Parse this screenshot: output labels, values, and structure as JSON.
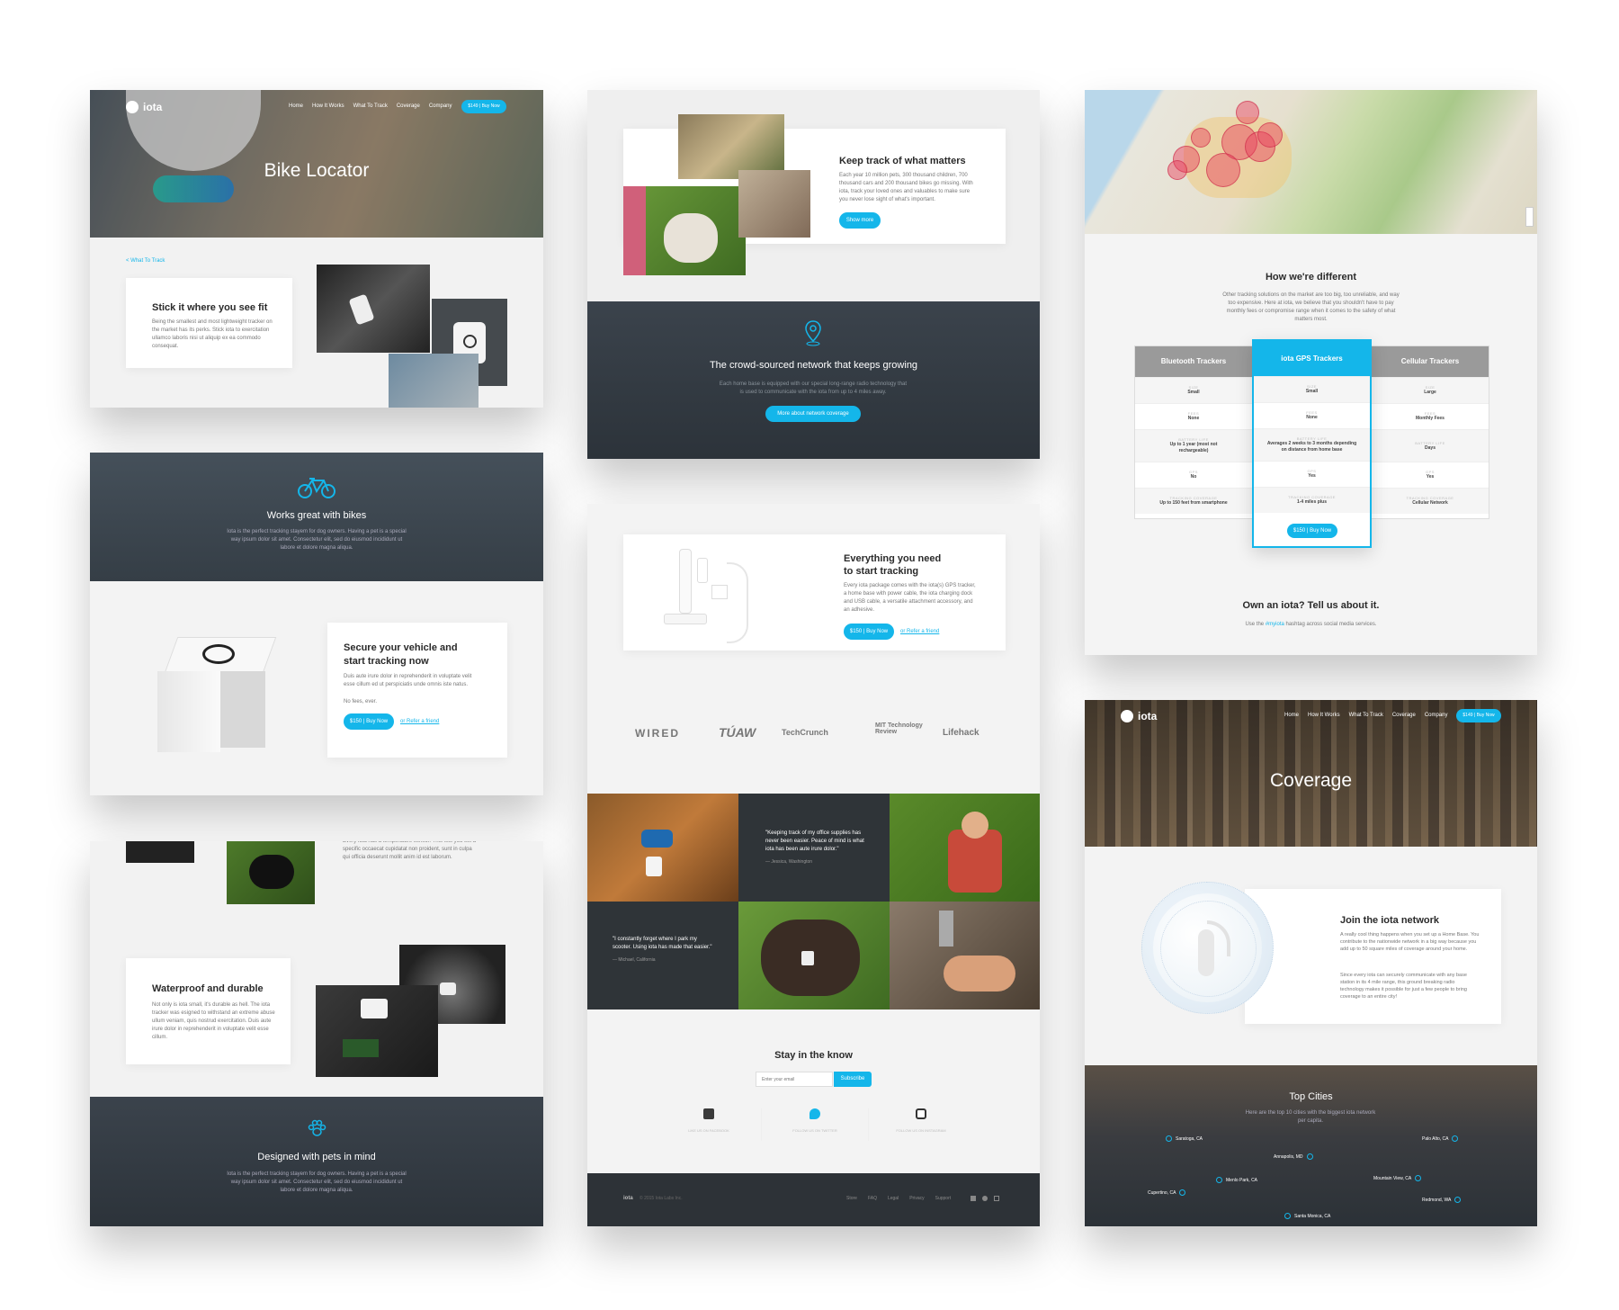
{
  "colors": {
    "accent": "#14b6ea",
    "dark": "#2f363d"
  },
  "brand": "iota",
  "nav": [
    "Home",
    "How It Works",
    "What To Track",
    "Coverage",
    "Company"
  ],
  "buy_nav": "$149 | Buy Now",
  "card1": {
    "hero_title": "Bike Locator",
    "breadcrumb": "< What To Track",
    "title": "Stick it where you see fit",
    "body": "Being the smallest and most lightweight tracker on the market has its perks. Stick iota to exercitation ullamco laboris nisi ut aliquip ex ea commodo consequat."
  },
  "card2": {
    "bike_icon": "bicycle-icon",
    "title": "Works great with bikes",
    "body": "Iota is the perfect tracking stayem for dog owners. Having a pet is a special way ipsum dolor sit amet. Consectetur elit, sed do eiusmod incididunt ut labore et dolore magna aliqua.",
    "secure_title_1": "Secure your vehicle and",
    "secure_title_2": "start tracking now",
    "secure_body": "Duis aute irure dolor in reprehenderit in voluptate velit esse cillum ed ut perspiciatis unde omnis iste natus.",
    "secure_note": "No fees, ever.",
    "buy": "$150 | Buy Now",
    "refer": "or Refer a friend"
  },
  "card3": {
    "top_text": "Every iota has a temperature sensor. This lets you set a specific occaecat cupidatat non proident, sunt in culpa qui officia deserunt mollit anim id est laborum.",
    "title": "Waterproof and durable",
    "body": "Not only is iota small, it's durable as hell. The iota tracker was esigned to withstand an extreme abuse ullum veniam, quis nostrud exercitation. Duis aute irure dolor in reprehenderit in voluptate velit esse cillum.",
    "pets_icon": "paw-icon",
    "pets_title": "Designed with pets in mind",
    "pets_body": "Iota is the perfect tracking stayem for dog owners. Having a pet is a special way ipsum dolor sit amet. Consectetur elit, sed do eiusmod incididunt ut labore et dolore magna aliqua."
  },
  "card4": {
    "title": "Keep track of what matters",
    "body": "Each year 10 million pets, 300 thousand children, 700 thousand cars and 200 thousand bikes go missing. With iota, track your loved ones and valuables to make sure you never lose sight of what's important.",
    "show_more": "Show more",
    "pin_icon": "location-pin-icon",
    "network_title": "The crowd-sourced network that keeps growing",
    "network_body": "Each home base is equipped with our special long-range radio technology that is used to communicate with the iota from up to 4 miles away.",
    "network_btn": "More about network coverage"
  },
  "card5": {
    "title_1": "Everything you need",
    "title_2": "to start tracking",
    "body": "Every iota package comes with the iota(s) GPS tracker, a home base with power cable, the iota charging dock and USB cable, a versatile attachment accessory, and an adhesive.",
    "buy": "$150 | Buy Now",
    "refer": "or Refer a friend",
    "press": [
      "WIRED",
      "TÚAW",
      "TechCrunch",
      "MIT Technology Review",
      "Lifehack"
    ],
    "quote1": "\"Keeping track of my office supplies has never been easier. Peace of mind is what iota has been aute irure dolor.\"",
    "quote1_by": "— Jessica, Washington",
    "quote2": "\"I constantly forget where I park my scooter. Using iota has made that easier.\"",
    "quote2_by": "— Michael, California",
    "newsletter_title": "Stay in the know",
    "email_placeholder": "Enter your email",
    "subscribe": "Subscribe",
    "social": [
      "LIKE US ON FACEBOOK",
      "FOLLOW US ON TWITTER",
      "FOLLOW US ON INSTAGRAM"
    ],
    "footer_brand": "iota",
    "footer_copy": "© 2015 Iota Labs Inc.",
    "footer_links": [
      "Store",
      "FAQ",
      "Legal",
      "Privacy",
      "Support"
    ]
  },
  "card6": {
    "diff_title": "How we're different",
    "diff_body": "Other tracking solutions on the market are too big, too unreliable, and way too expensive. Here at iota, we believe that you shouldn't have to pay monthly fees or compromise range when it comes to the safety of what matters most.",
    "columns": [
      {
        "name": "Bluetooth Trackers",
        "rows": [
          [
            "Size",
            "Small"
          ],
          [
            "Fees",
            "None"
          ],
          [
            "Battery Life",
            "Up to 1 year (most not rechargeable)"
          ],
          [
            "GPS",
            "No"
          ],
          [
            "Tracking Coverage",
            "Up to 150 feet from smartphone"
          ]
        ]
      },
      {
        "name": "iota GPS Trackers",
        "rows": [
          [
            "Size",
            "Small"
          ],
          [
            "Fees",
            "None"
          ],
          [
            "Battery Life",
            "Averages 2 weeks to 3 months depending on distance from home base"
          ],
          [
            "GPS",
            "Yes"
          ],
          [
            "Tracking Coverage",
            "1-4 miles plus"
          ]
        ]
      },
      {
        "name": "Cellular Trackers",
        "rows": [
          [
            "Size",
            "Large"
          ],
          [
            "Fees",
            "Monthly Fees"
          ],
          [
            "Battery Life",
            "Days"
          ],
          [
            "GPS",
            "Yes"
          ],
          [
            "Tracking Coverage",
            "Cellular Network"
          ]
        ]
      }
    ],
    "buy": "$150 | Buy Now",
    "own_title": "Own an iota? Tell us about it.",
    "own_body_1": "Use the ",
    "hashtag": "#myiota",
    "own_body_2": " hashtag across social media services."
  },
  "card7": {
    "hero_title": "Coverage",
    "join_title": "Join the iota network",
    "join_body_1": "A really cool thing happens when you set up a Home Base. You contribute to the nationwide network in a big way because you add up to 50 square miles of coverage around your home.",
    "join_body_2": "Since every iota can securely communicate with any base station in its 4 mile range, this ground breaking radio technology makes it possible for just a few people to bring coverage to an entire city!",
    "top_title": "Top Cities",
    "top_body": "Here are the top 10 cities with the biggest iota network per capita.",
    "cities": [
      "Saratoga, CA",
      "Annapolis, MD",
      "Palo Alto, CA",
      "Menlo Park, CA",
      "Mountain View, CA",
      "Cupertino, CA",
      "Redmond, WA",
      "Santa Monica, CA"
    ]
  }
}
